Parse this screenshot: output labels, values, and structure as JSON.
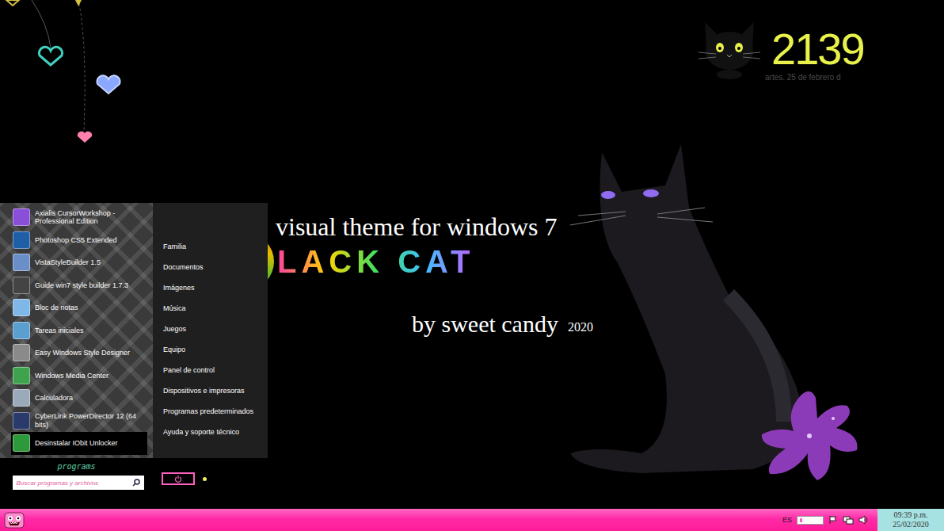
{
  "clock_widget": {
    "time": "2139",
    "date": "artes. 25 de febrero d"
  },
  "wallpaper": {
    "title": "visual theme for windows 7",
    "logo_letter": "B",
    "name": "LACK CAT",
    "byline": "by sweet candy",
    "year": "2020"
  },
  "start_menu": {
    "programs": [
      {
        "label": "Axialis CursorWorkshop - Professional Edition",
        "selected": false
      },
      {
        "label": "Photoshop CS5 Extended",
        "selected": false
      },
      {
        "label": "VistaStyleBuilder 1.5",
        "selected": false
      },
      {
        "label": "Guide win7 style builder 1.7.3",
        "selected": false
      },
      {
        "label": "Bloc de notas",
        "selected": false
      },
      {
        "label": "Tareas iniciales",
        "selected": false
      },
      {
        "label": "Easy Windows Style Designer",
        "selected": false
      },
      {
        "label": "Windows Media Center",
        "selected": false
      },
      {
        "label": "Calculadora",
        "selected": false
      },
      {
        "label": "CyberLink PowerDirector 12 (64 bits)",
        "selected": false
      },
      {
        "label": "Desinstalar IObit Unlocker",
        "selected": true
      }
    ],
    "all_programs_label": "programs",
    "search": {
      "placeholder": "Buscar programas y archivos"
    },
    "places": [
      "Familia",
      "Documentos",
      "Imágenes",
      "Música",
      "Juegos",
      "Equipo",
      "Panel de control",
      "Dispositivos e impresoras",
      "Programas predeterminados",
      "Ayuda y soporte técnico"
    ]
  },
  "taskbar": {
    "language": "ES",
    "clock": {
      "time": "09:39 p.m.",
      "date": "25/02/2020"
    }
  }
}
